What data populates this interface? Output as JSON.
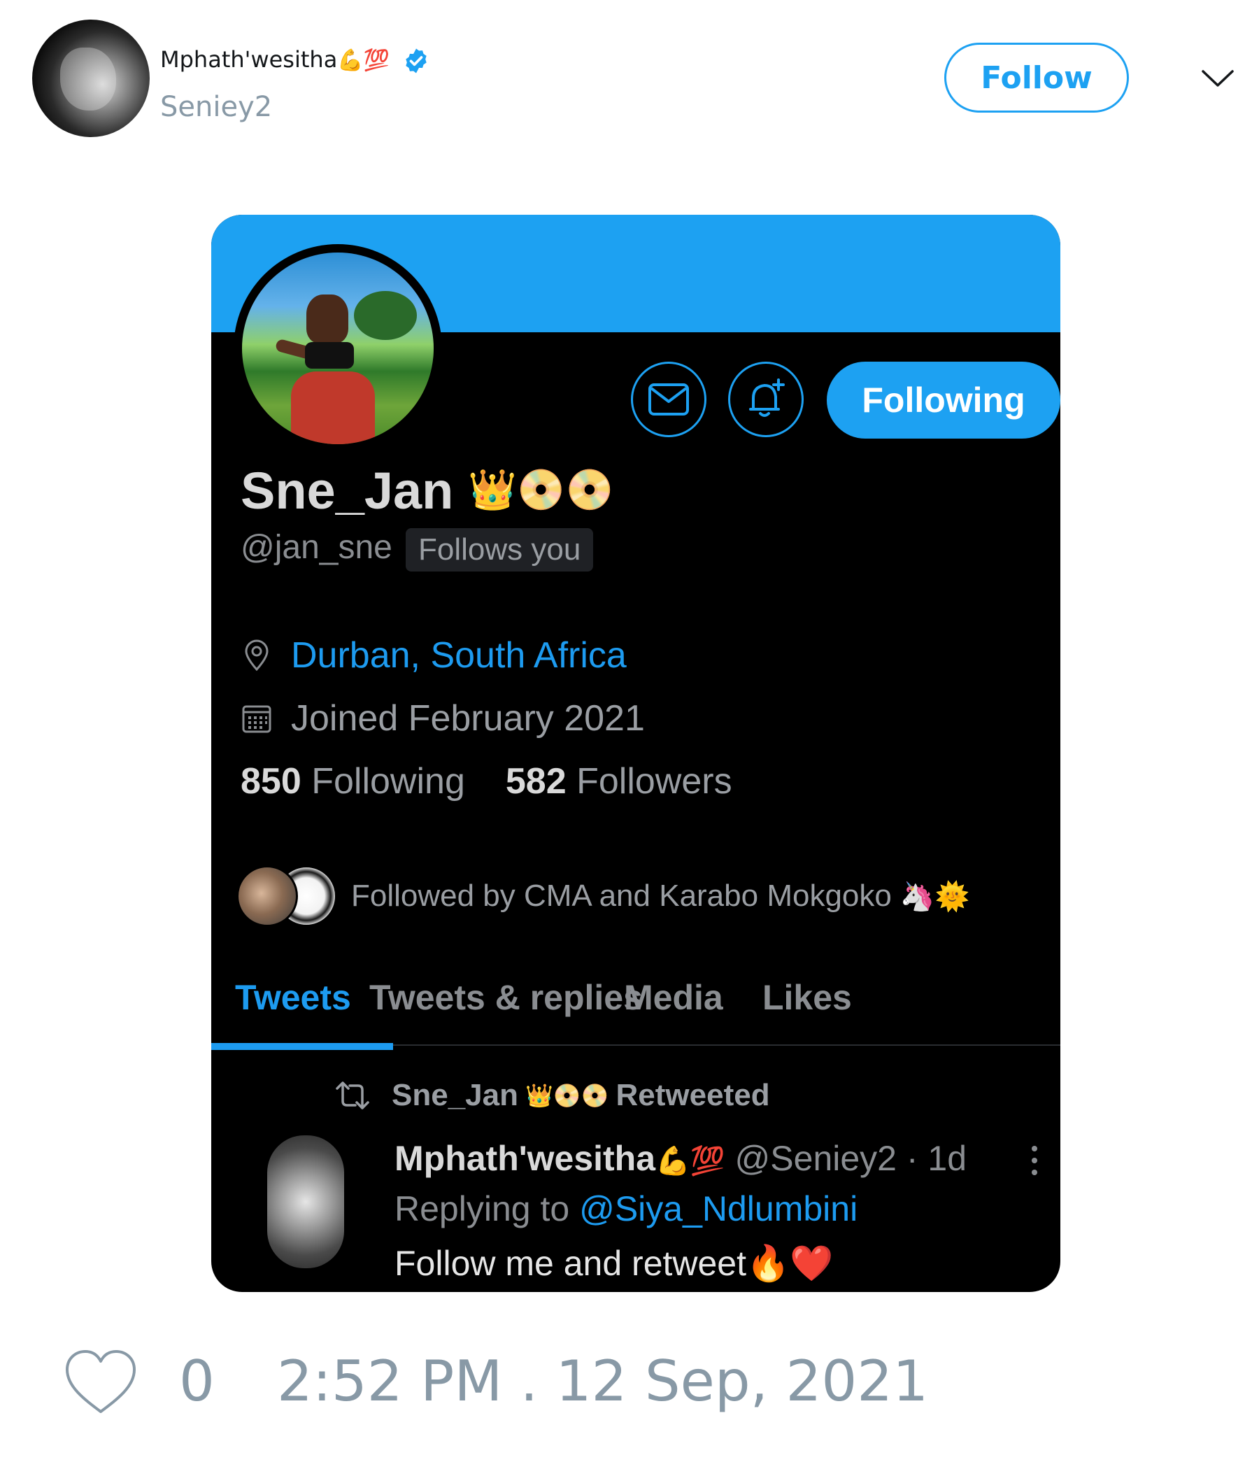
{
  "tweet": {
    "author_name": "Mphath'wesitha",
    "author_emojis": "💪💯",
    "author_handle": "Seniey2",
    "follow_label": "Follow",
    "like_count": "0",
    "timestamp": "2:52 PM . 12 Sep, 2021"
  },
  "profile": {
    "display_name": "Sne_Jan",
    "name_emojis": "👑📀📀",
    "handle": "@jan_sne",
    "follows_you": "Follows you",
    "following_button": "Following",
    "location": "Durban, South Africa",
    "joined": "Joined February 2021",
    "following_count": "850",
    "following_label": "Following",
    "followers_count": "582",
    "followers_label": "Followers",
    "followed_by": "Followed by CMA and Karabo Mokgoko",
    "followed_by_emojis": "🦄🌞",
    "tabs": [
      "Tweets",
      "Tweets & replies",
      "Media",
      "Likes"
    ],
    "active_tab": "Tweets"
  },
  "pinned_tweet": {
    "retweeted_by": "Sne_Jan",
    "retweeted_emojis": "👑📀📀",
    "retweeted_label": "Retweeted",
    "author_name": "Mphath'wesitha",
    "author_emojis": "💪💯",
    "author_handle_time": "@Seniey2 · 1d",
    "replying_to_label": "Replying to",
    "replying_to_user": "@Siya_Ndlumbini",
    "text": "Follow me and retweet",
    "text_emojis": "🔥❤️"
  },
  "colors": {
    "accent": "#1da1f2",
    "card_background": "#000000",
    "muted_text": "#8899a6"
  },
  "icons": [
    "verified-badge-icon",
    "chevron-down-icon",
    "envelope-icon",
    "bell-plus-icon",
    "location-pin-icon",
    "calendar-icon",
    "retweet-icon",
    "kebab-menu-icon",
    "heart-icon"
  ]
}
